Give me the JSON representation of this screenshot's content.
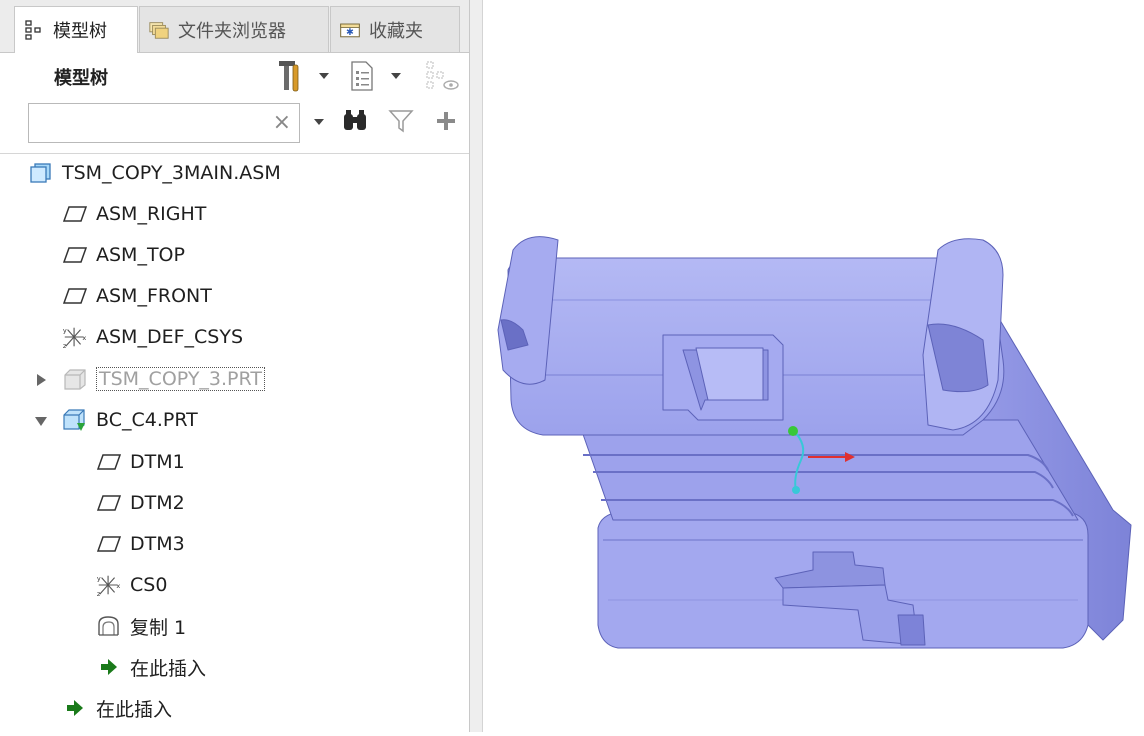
{
  "tabs": [
    {
      "label": "模型树",
      "icon": "model-tree-icon",
      "active": true
    },
    {
      "label": "文件夹浏览器",
      "icon": "folder-browser-icon",
      "active": false
    },
    {
      "label": "收藏夹",
      "icon": "favorites-icon",
      "active": false
    }
  ],
  "panel": {
    "title": "模型树",
    "search": {
      "value": "",
      "placeholder": "",
      "clear_glyph": "×"
    }
  },
  "tree": [
    {
      "label": "TSM_COPY_3MAIN.ASM",
      "icon": "assembly-icon"
    },
    {
      "label": "ASM_RIGHT",
      "icon": "datum-plane-icon"
    },
    {
      "label": "ASM_TOP",
      "icon": "datum-plane-icon"
    },
    {
      "label": "ASM_FRONT",
      "icon": "datum-plane-icon"
    },
    {
      "label": "ASM_DEF_CSYS",
      "icon": "csys-icon"
    },
    {
      "label": "TSM_COPY_3.PRT",
      "icon": "part-icon",
      "expander": "collapsed",
      "dimmed": true
    },
    {
      "label": "BC_C4.PRT",
      "icon": "part-active-icon",
      "expander": "expanded"
    },
    {
      "label": "DTM1",
      "icon": "datum-plane-icon"
    },
    {
      "label": "DTM2",
      "icon": "datum-plane-icon"
    },
    {
      "label": "DTM3",
      "icon": "datum-plane-icon"
    },
    {
      "label": "CS0",
      "icon": "csys-icon"
    },
    {
      "label": "复制 1",
      "icon": "copy-surface-icon"
    },
    {
      "label": "在此插入",
      "icon": "insert-here-arrow-icon"
    },
    {
      "label": "在此插入",
      "icon": "insert-here-arrow-icon"
    }
  ],
  "colors": {
    "part_fill": "#a9aef0",
    "part_shade": "#8a90e0",
    "part_edge": "#5c62b8",
    "insert_arrow": "#1a7a1a",
    "axis_red": "#e03030",
    "axis_green": "#38c838",
    "axis_cyan": "#38c8d8"
  }
}
